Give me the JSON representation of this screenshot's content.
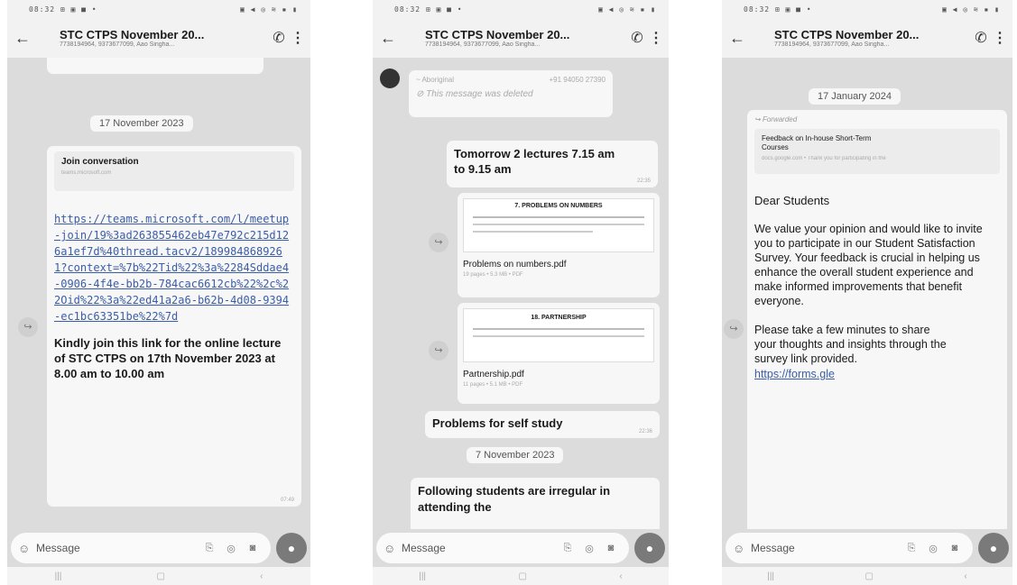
{
  "phones": [
    {
      "status_left": "08:32 ⊞ ▣ ■ •",
      "status_right": "▣ ◀ ◎ ≋ ▪ ▮",
      "title": "STC CTPS November 20...",
      "subtitle": "7738194964, 9373677099, Aao Singha...",
      "date1": "17 November 2023",
      "join_title": "Join conversation",
      "join_sub": "teams.microsoft.com",
      "link_text": "https://teams.microsoft.com/l/meetup-join/19%3ad263855462eb47e792c215d126a1ef7d%40thread.tacv2/1899848689261?context=%7b%22Tid%22%3a%2284Sddae4-0906-4f4e-bb2b-784cac6612cb%22%2c%22Oid%22%3a%22ed41a2a6-b62b-4d08-9394-ec1bc63351be%22%7d",
      "message_text": "Kindly join this link for the online lecture of STC CTPS on 17th November 2023 at 8.00 am to 10.00 am",
      "message_time": "07:49",
      "input_placeholder": "Message"
    },
    {
      "status_left": "08:32 ⊞ ▣ ■ •",
      "status_right": "▣ ◀ ◎ ≋ ▪ ▮",
      "title": "STC CTPS November 20...",
      "subtitle": "7738194964, 9373677099, Aao Singha...",
      "deleted_sender": "~ Aboriginal",
      "deleted_phone": "+91 94050 27390",
      "deleted_text": "This message was deleted",
      "lecture_text": "Tomorrow 2 lectures 7.15 am to 9.15 am",
      "lecture_time": "22:35",
      "file1_preview_title": "7. PROBLEMS ON NUMBERS",
      "file1_name": "Problems on numbers.pdf",
      "file1_meta": "19 pages • 5.3 MB • PDF",
      "file2_preview_title": "18. PARTNERSHIP",
      "file2_name": "Partnership.pdf",
      "file2_meta": "11 pages • 5.1 MB • PDF",
      "selfstudy_text": "Problems for self study",
      "selfstudy_time": "22:36",
      "date2": "7 November 2023",
      "irregular_text": "Following students are irregular in attending the",
      "input_placeholder": "Message"
    },
    {
      "status_left": "08:32 ⊞ ▣ ■ •",
      "status_right": "▣ ◀ ◎ ≋ ▪ ▮",
      "title": "STC CTPS November 20...",
      "subtitle": "7738194964, 9373677099, Aao Singha...",
      "date3": "17 January 2024",
      "forwarded": "Forwarded",
      "feedback_title": "Feedback on In-house Short-Term Courses",
      "feedback_sub": "docs.google.com • Thank you for participating in the",
      "dear": "Dear Students",
      "para1": "We value your opinion and would like to invite you to participate in our Student Satisfaction Survey. Your feedback is crucial in helping us enhance the overall student experience and make informed improvements that benefit everyone.",
      "para2": "Please take a few minutes to share your thoughts and insights through the survey link provided.",
      "link_text": "https://forms.gle",
      "input_placeholder": "Message"
    }
  ],
  "icons": {
    "back": "←",
    "call": "✆",
    "menu": "⋮",
    "forward": "↪",
    "emoji": "☺",
    "attach": "⎘",
    "rupee": "◎",
    "camera": "◙",
    "mic": "●",
    "deleted": "⊘",
    "nav_recent": "|||",
    "nav_home": "▢",
    "nav_back": "‹"
  }
}
